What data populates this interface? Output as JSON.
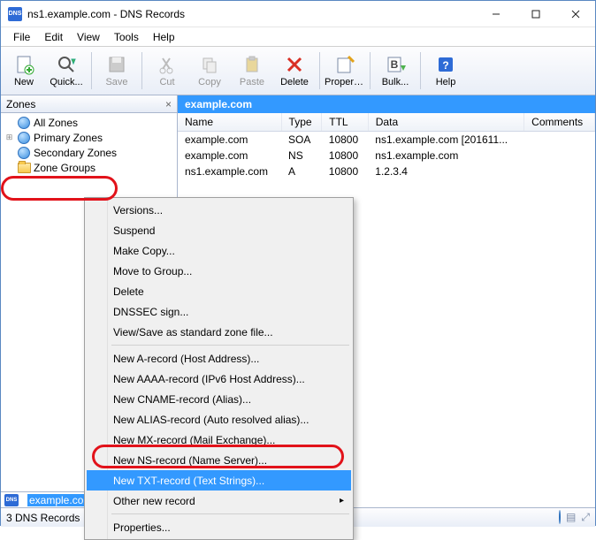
{
  "title": "ns1.example.com - DNS Records",
  "menubar": [
    "File",
    "Edit",
    "View",
    "Tools",
    "Help"
  ],
  "toolbar": {
    "new": "New",
    "quick": "Quick...",
    "save": "Save",
    "cut": "Cut",
    "copy": "Copy",
    "paste": "Paste",
    "delete": "Delete",
    "properties": "Properties",
    "bulk": "Bulk...",
    "help": "Help"
  },
  "sidebar": {
    "header": "Zones",
    "items": [
      {
        "label": "All Zones"
      },
      {
        "label": "Primary Zones"
      },
      {
        "label": "Secondary Zones"
      },
      {
        "label": "Zone Groups"
      }
    ],
    "selected": "example.com"
  },
  "crumb": "example.com",
  "grid": {
    "cols": [
      "Name",
      "Type",
      "TTL",
      "Data",
      "Comments"
    ],
    "rows": [
      {
        "name": "example.com",
        "type": "SOA",
        "ttl": "10800",
        "data": "ns1.example.com [201611...",
        "comments": ""
      },
      {
        "name": "example.com",
        "type": "NS",
        "ttl": "10800",
        "data": "ns1.example.com",
        "comments": ""
      },
      {
        "name": "ns1.example.com",
        "type": "A",
        "ttl": "10800",
        "data": "1.2.3.4",
        "comments": ""
      }
    ]
  },
  "ctx": {
    "versions": "Versions...",
    "suspend": "Suspend",
    "makecopy": "Make Copy...",
    "movegroup": "Move to Group...",
    "delete": "Delete",
    "dnssec": "DNSSEC sign...",
    "viewsave": "View/Save as standard zone file...",
    "newa": "New A-record (Host Address)...",
    "newaaaa": "New AAAA-record (IPv6 Host Address)...",
    "newcname": "New CNAME-record (Alias)...",
    "newalias": "New ALIAS-record (Auto resolved alias)...",
    "newmx": "New MX-record (Mail Exchange)...",
    "newns": "New NS-record (Name Server)...",
    "newtxt": "New TXT-record (Text Strings)...",
    "other": "Other new record",
    "properties": "Properties..."
  },
  "status": "3 DNS Records"
}
